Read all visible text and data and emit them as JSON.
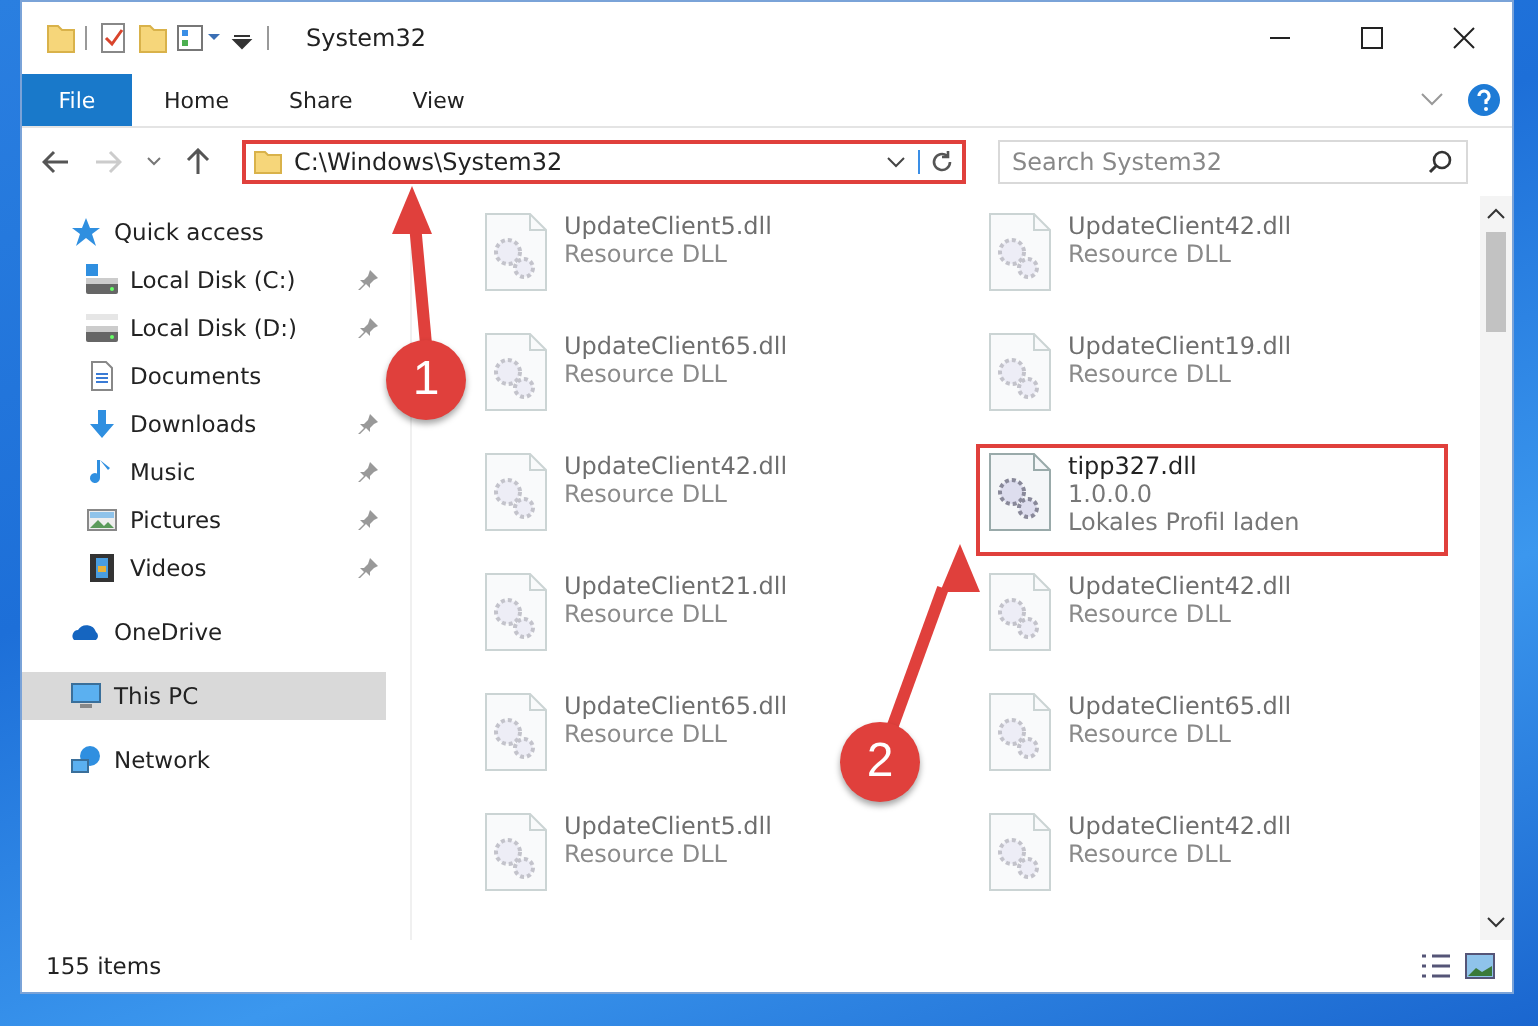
{
  "window": {
    "title": "System32"
  },
  "ribbon_tabs": [
    {
      "label": "File",
      "kind": "menu"
    },
    {
      "label": "Home",
      "kind": "tab"
    },
    {
      "label": "Share",
      "kind": "tab"
    },
    {
      "label": "View",
      "kind": "tab"
    }
  ],
  "address": {
    "path": "C:\\Windows\\System32",
    "highlighted": true
  },
  "search": {
    "placeholder": "Search System32"
  },
  "sidebar": {
    "items": [
      {
        "label": "Quick access",
        "selected": false,
        "children": [
          {
            "label": "Local Disk (C:)",
            "pinned": true,
            "selected": false
          },
          {
            "label": "Local Disk (D:)",
            "pinned": true,
            "selected": false
          },
          {
            "label": "Documents",
            "pinned": false,
            "selected": false
          },
          {
            "label": "Downloads",
            "pinned": true,
            "selected": false
          },
          {
            "label": "Music",
            "pinned": true,
            "selected": false
          },
          {
            "label": "Pictures",
            "pinned": true,
            "selected": false
          },
          {
            "label": "Videos",
            "pinned": true,
            "selected": false
          }
        ]
      },
      {
        "label": "OneDrive",
        "selected": false
      },
      {
        "label": "This PC",
        "selected": true
      },
      {
        "label": "Network",
        "selected": false
      }
    ]
  },
  "files": [
    {
      "name": "UpdateClient5.dll",
      "details": [
        "Resource DLL"
      ],
      "blurred": true,
      "highlighted": false
    },
    {
      "name": "UpdateClient42.dll",
      "details": [
        "Resource DLL"
      ],
      "blurred": true,
      "highlighted": false
    },
    {
      "name": "UpdateClient65.dll",
      "details": [
        "Resource DLL"
      ],
      "blurred": true,
      "highlighted": false
    },
    {
      "name": "UpdateClient19.dll",
      "details": [
        "Resource DLL"
      ],
      "blurred": true,
      "highlighted": false
    },
    {
      "name": "UpdateClient42.dll",
      "details": [
        "Resource DLL"
      ],
      "blurred": true,
      "highlighted": false
    },
    {
      "name": "tipp327.dll",
      "details": [
        "1.0.0.0",
        "Lokales Profil laden"
      ],
      "blurred": false,
      "highlighted": true
    },
    {
      "name": "UpdateClient21.dll",
      "details": [
        "Resource DLL"
      ],
      "blurred": true,
      "highlighted": false
    },
    {
      "name": "UpdateClient42.dll",
      "details": [
        "Resource DLL"
      ],
      "blurred": true,
      "highlighted": false
    },
    {
      "name": "UpdateClient65.dll",
      "details": [
        "Resource DLL"
      ],
      "blurred": true,
      "highlighted": false
    },
    {
      "name": "UpdateClient65.dll",
      "details": [
        "Resource DLL"
      ],
      "blurred": true,
      "highlighted": false
    },
    {
      "name": "UpdateClient5.dll",
      "details": [
        "Resource DLL"
      ],
      "blurred": true,
      "highlighted": false
    },
    {
      "name": "UpdateClient42.dll",
      "details": [
        "Resource DLL"
      ],
      "blurred": true,
      "highlighted": false
    }
  ],
  "status_bar": {
    "item_count": "155 items"
  },
  "annotations": [
    {
      "label": "1"
    },
    {
      "label": "2"
    }
  ]
}
